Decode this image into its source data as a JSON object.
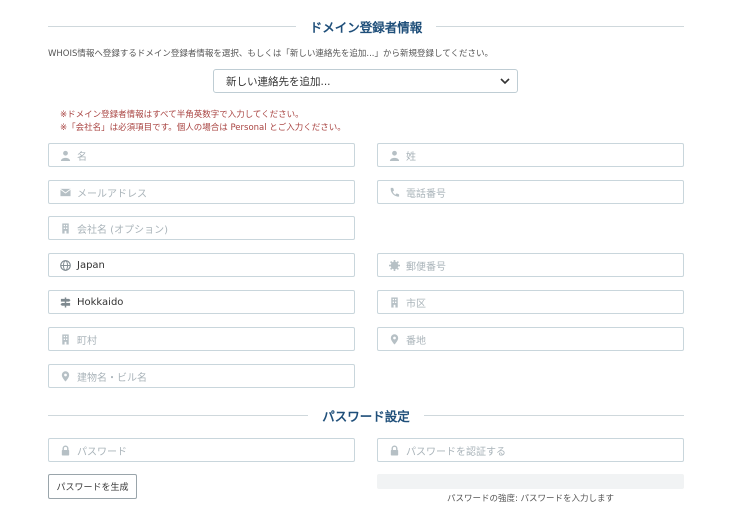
{
  "registrant": {
    "title": "ドメイン登録者情報",
    "intro": "WHOIS情報へ登録するドメイン登録者情報を選択、もしくは「新しい連絡先を追加...」から新規登録してください。",
    "contact_select": {
      "selected": "新しい連絡先を追加..."
    },
    "notes": [
      "※ドメイン登録者情報はすべて半角英数字で入力してください。",
      "※「会社名」は必須項目です。個人の場合は Personal とご入力ください。"
    ],
    "fields": {
      "first_name": {
        "placeholder": "名",
        "value": "",
        "icon": "user-icon"
      },
      "last_name": {
        "placeholder": "姓",
        "value": "",
        "icon": "user-icon"
      },
      "email": {
        "placeholder": "メールアドレス",
        "value": "",
        "icon": "envelope-icon"
      },
      "phone": {
        "placeholder": "電話番号",
        "value": "",
        "icon": "phone-icon"
      },
      "company": {
        "placeholder": "会社名 (オプション)",
        "value": "",
        "icon": "building-icon"
      },
      "country": {
        "placeholder": "",
        "value": "Japan",
        "icon": "globe-icon"
      },
      "postal": {
        "placeholder": "郵便番号",
        "value": "",
        "icon": "seal-icon"
      },
      "prefecture": {
        "placeholder": "",
        "value": "Hokkaido",
        "icon": "signpost-icon"
      },
      "city": {
        "placeholder": "市区",
        "value": "",
        "icon": "building-icon"
      },
      "town": {
        "placeholder": "町村",
        "value": "",
        "icon": "building-icon"
      },
      "address": {
        "placeholder": "番地",
        "value": "",
        "icon": "map-marker-icon"
      },
      "building": {
        "placeholder": "建物名・ビル名",
        "value": "",
        "icon": "map-marker-icon"
      }
    }
  },
  "password": {
    "title": "パスワード設定",
    "password_field": {
      "placeholder": "パスワード",
      "icon": "lock-icon"
    },
    "confirm_field": {
      "placeholder": "パスワードを認証する",
      "icon": "lock-icon"
    },
    "generate_button": "パスワードを生成",
    "strength_text": "パスワードの強度: パスワードを入力します",
    "strength_level": 0
  },
  "colors": {
    "title": "#1f4f7a",
    "note": "#a94442",
    "border": "#c9d6dc",
    "placeholder": "#aab4ba"
  }
}
